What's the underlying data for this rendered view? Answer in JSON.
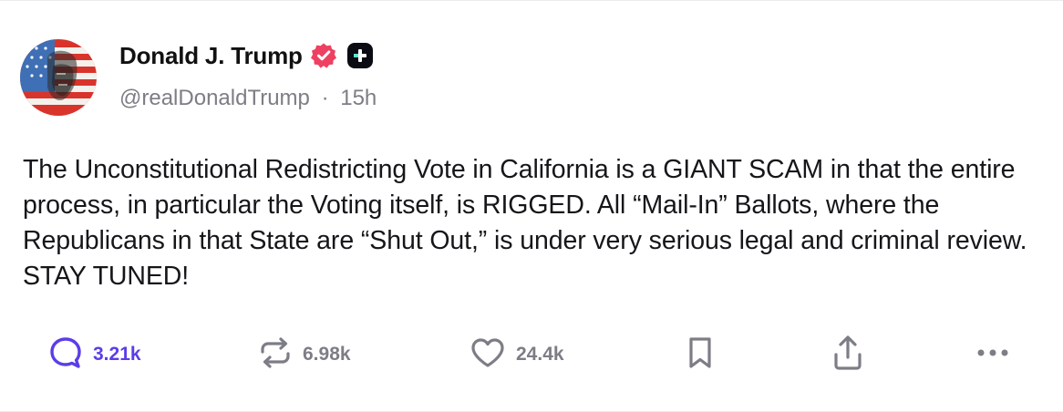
{
  "post": {
    "author": {
      "display_name": "Donald J. Trump",
      "handle": "@realDonaldTrump",
      "separator": "·",
      "time_ago": "15h"
    },
    "text": "The Unconstitutional Redistricting Vote in California is a GIANT SCAM in that the entire process, in particular the Voting itself, is RIGGED. All “Mail-In” Ballots, where the Republicans in that State are “Shut Out,” is under very serious legal and criminal review. STAY TUNED!",
    "actions": {
      "replies": "3.21k",
      "reposts": "6.98k",
      "likes": "24.4k"
    }
  },
  "icons": {
    "verified": "verified-badge-icon",
    "subscriber": "plus-badge-icon",
    "reply": "comment-bubble-icon",
    "repost": "repost-icon",
    "like": "heart-icon",
    "bookmark": "bookmark-icon",
    "share": "share-icon",
    "more": "more-dots-icon"
  },
  "colors": {
    "accent": "#5b3de8",
    "verified": "#ee4162",
    "muted": "#7d7d86",
    "text": "#16161a"
  }
}
